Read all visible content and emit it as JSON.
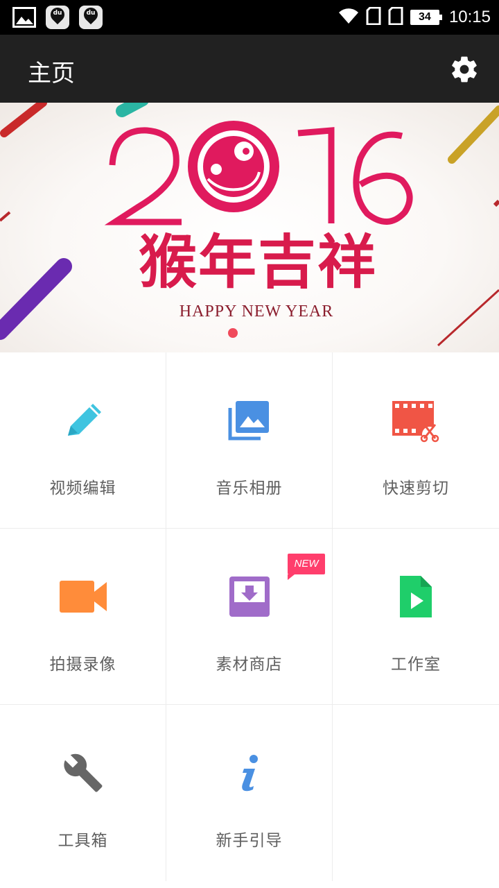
{
  "status_bar": {
    "left_icons": [
      "image-icon",
      "du-pin-icon",
      "du-pin-icon"
    ],
    "du_text": "du",
    "battery": "34",
    "time": "10:15"
  },
  "toolbar": {
    "title": "主页",
    "settings_icon": "gear-icon"
  },
  "banner": {
    "year": "2016",
    "title_cn": "猴年吉祥",
    "subtitle_en": "HAPPY NEW YEAR",
    "page_indicator": {
      "current": 1,
      "total": 1
    }
  },
  "menu": {
    "items": [
      {
        "label": "视频编辑",
        "icon": "pencil-icon",
        "color": "#3fc4e0"
      },
      {
        "label": "音乐相册",
        "icon": "photo-album-icon",
        "color": "#4a90e2"
      },
      {
        "label": "快速剪切",
        "icon": "film-scissors-icon",
        "color": "#f05545"
      },
      {
        "label": "拍摄录像",
        "icon": "video-camera-icon",
        "color": "#ff8c3a"
      },
      {
        "label": "素材商店",
        "icon": "download-box-icon",
        "color": "#a06cc9",
        "badge": "NEW"
      },
      {
        "label": "工作室",
        "icon": "video-file-icon",
        "color": "#1fce6a"
      },
      {
        "label": "工具箱",
        "icon": "wrench-icon",
        "color": "#666666"
      },
      {
        "label": "新手引导",
        "icon": "info-icon",
        "color": "#4a90e2"
      }
    ]
  }
}
